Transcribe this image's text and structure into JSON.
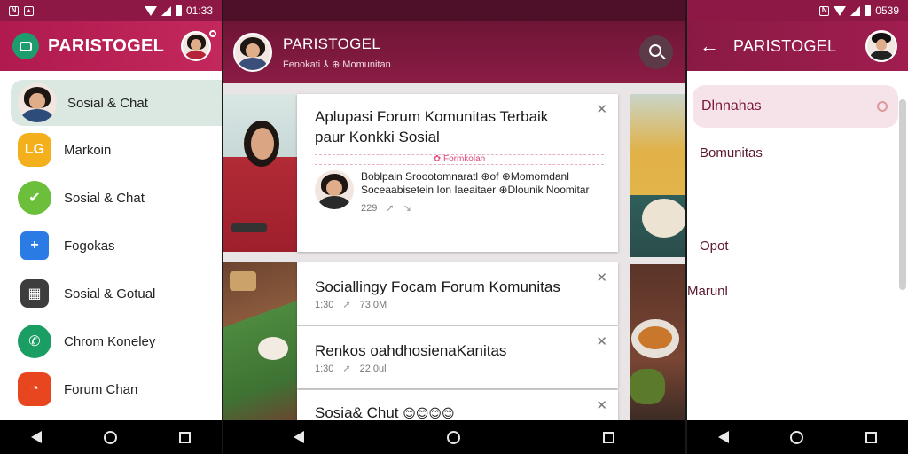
{
  "status": {
    "left_time": "01:33",
    "right_time": "0539"
  },
  "app": {
    "brand": "PARISTOGEL"
  },
  "left_menu": {
    "items": [
      {
        "label": "Sosial & Chat",
        "icon": "profile-avatar",
        "color": "#dbe8e2"
      },
      {
        "label": "Markoin",
        "icon": "lg-app-icon",
        "color": "#f3b01c"
      },
      {
        "label": "Sosial & Chat",
        "icon": "check-leaf-icon",
        "color": "#6cbf3a"
      },
      {
        "label": "Fogokas",
        "icon": "plus-chat-icon",
        "color": "#2b7be4"
      },
      {
        "label": "Sosial & Gotual",
        "icon": "grid-icon",
        "color": "#3d3d3d"
      },
      {
        "label": "Chrom Koneley",
        "icon": "phone-icon",
        "color": "#1a9e64"
      },
      {
        "label": "Forum Chan",
        "icon": "forum-icon",
        "color": "#e8461e"
      }
    ]
  },
  "middle": {
    "title": "PARISTOGEL",
    "subtitle": "Fenokati ⅄ ⊕ Momunitan",
    "cards": [
      {
        "title": "Aplupasi Forum Komunitas Terbaik paur Konkki Sosial",
        "divider_label": "✿ Formkolan",
        "comment": "Boblpain Sroootomnaratl ⊕of ⊕Momomdanl Soceaabisetein Ion Iaeaitaer ⊕Dlounik Noomitar",
        "time": "229",
        "share": "➚"
      },
      {
        "title": "Sociallingy Focam Forum Komunitas",
        "time": "1:30",
        "count": "73.0M"
      },
      {
        "title": "Renkos oahdhosienaKanitas",
        "time": "1:30",
        "count": "22.0ul"
      },
      {
        "title": "Sosia& Chut",
        "emojis": "😊😊😊😊"
      }
    ]
  },
  "right": {
    "search_value": "Dlnnahas",
    "items": [
      "Bomunitas",
      "Opot",
      "Marunl"
    ]
  },
  "colors": {
    "brand": "#8d1745",
    "accent": "#c3285c"
  }
}
